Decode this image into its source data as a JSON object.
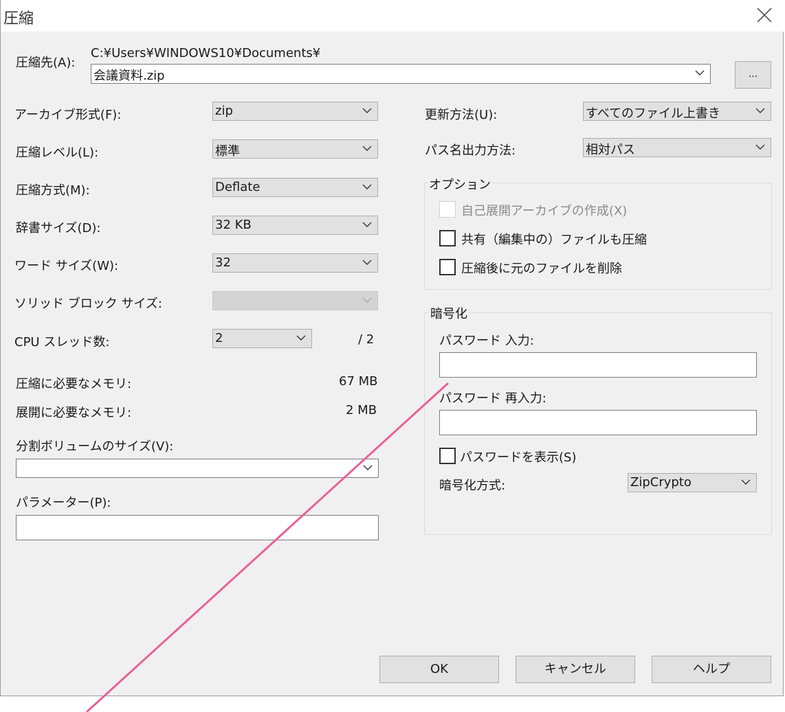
{
  "window": {
    "title": "圧縮"
  },
  "dest": {
    "label": "圧縮先(A):",
    "path": "C:¥Users¥WINDOWS10¥Documents¥",
    "value": "会議資料.zip",
    "browse_label": "..."
  },
  "left": {
    "archive_format": {
      "label": "アーカイブ形式(F):",
      "value": "zip"
    },
    "level": {
      "label": "圧縮レベル(L):",
      "value": "標準"
    },
    "method": {
      "label": "圧縮方式(M):",
      "value": "Deflate"
    },
    "dict": {
      "label": "辞書サイズ(D):",
      "value": "32 KB"
    },
    "word": {
      "label": "ワード サイズ(W):",
      "value": "32"
    },
    "solid": {
      "label": "ソリッド ブロック サイズ:",
      "value": ""
    },
    "cpu": {
      "label": "CPU スレッド数:",
      "value": "2",
      "max": "/ 2"
    },
    "mem_comp": {
      "label": "圧縮に必要なメモリ:",
      "value": "67 MB"
    },
    "mem_decomp": {
      "label": "展開に必要なメモリ:",
      "value": "2 MB"
    },
    "split": {
      "label": "分割ボリュームのサイズ(V):",
      "value": ""
    },
    "params": {
      "label": "パラメーター(P):",
      "value": ""
    }
  },
  "right": {
    "update": {
      "label": "更新方法(U):",
      "value": "すべてのファイル上書き"
    },
    "pathmode": {
      "label": "パス名出力方法:",
      "value": "相対パス"
    },
    "options": {
      "title": "オプション",
      "sfx": "自己展開アーカイブの作成(X)",
      "shared": "共有（編集中の）ファイルも圧縮",
      "delete": "圧縮後に元のファイルを削除"
    },
    "encryption": {
      "title": "暗号化",
      "pw_label": "パスワード 入力:",
      "pw_value": "",
      "pw2_label": "パスワード 再入力:",
      "pw2_value": "",
      "show": "パスワードを表示(S)",
      "method_label": "暗号化方式:",
      "method_value": "ZipCrypto"
    }
  },
  "buttons": {
    "ok": "OK",
    "cancel": "キャンセル",
    "help": "ヘルプ"
  },
  "colors": {
    "annotation_line": "#e8609a"
  }
}
